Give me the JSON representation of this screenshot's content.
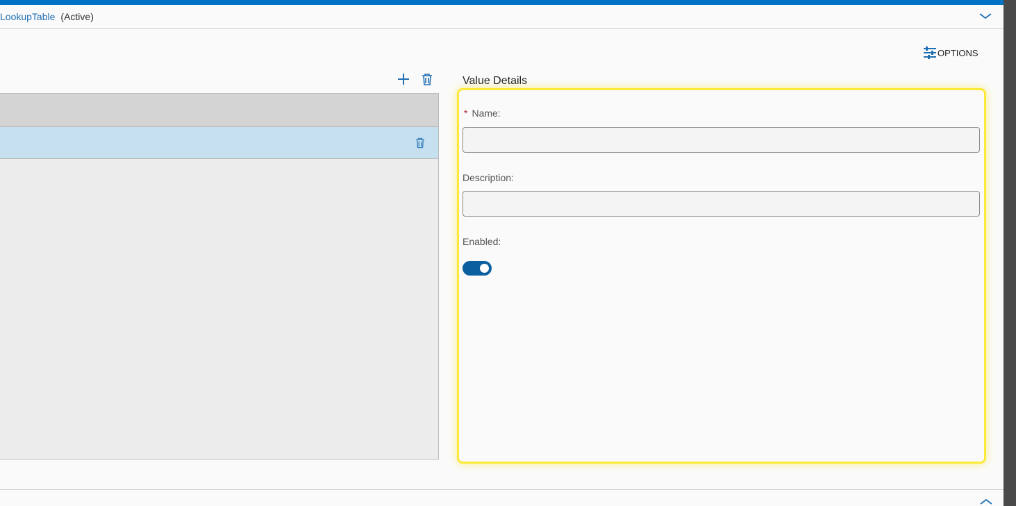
{
  "header": {
    "title": "LookupTable",
    "status": "(Active)"
  },
  "toolbar": {
    "options_label": "OPTIONS"
  },
  "details": {
    "title": "Value Details",
    "name_label": "Name:",
    "required_mark": "*",
    "name_value": "",
    "description_label": "Description:",
    "description_value": "",
    "enabled_label": "Enabled:",
    "enabled": true
  },
  "colors": {
    "accent": "#0073c6",
    "highlight": "#fde93a",
    "selected_row": "#c7e0ef",
    "required": "#b0243a"
  }
}
